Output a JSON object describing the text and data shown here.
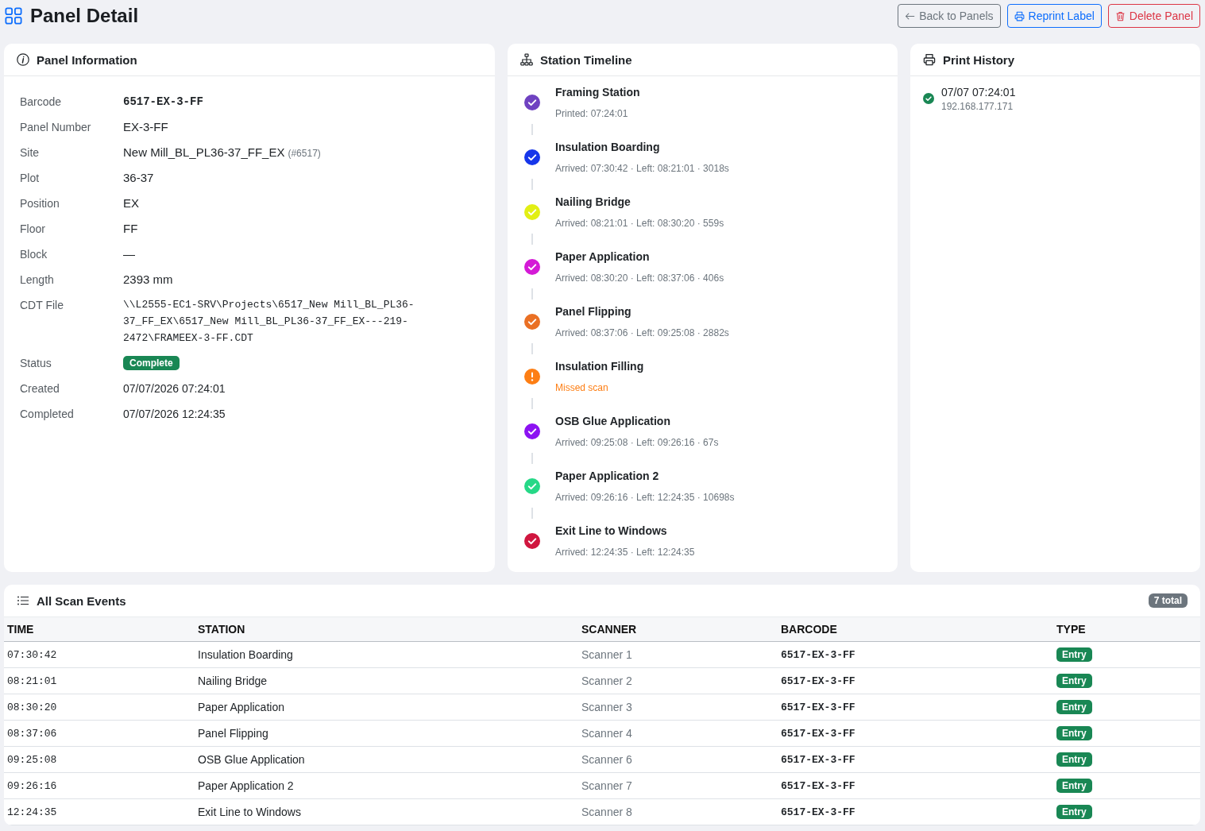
{
  "header": {
    "title": "Panel Detail",
    "buttons": [
      {
        "label": "Back to Panels",
        "kind": "back"
      },
      {
        "label": "Reprint Label",
        "kind": "reprint"
      },
      {
        "label": "Delete Panel",
        "kind": "delete"
      }
    ]
  },
  "panel_info": {
    "title": "Panel Information",
    "fields": [
      {
        "label": "Barcode",
        "value": "6517-EX-3-FF",
        "kind": "code-bold"
      },
      {
        "label": "Panel Number",
        "value": "EX-3-FF",
        "kind": "text"
      },
      {
        "label": "Site",
        "value": "New Mill_BL_PL36-37_FF_EX",
        "note": "(#6517)",
        "kind": "text"
      },
      {
        "label": "Plot",
        "value": "36-37",
        "kind": "text"
      },
      {
        "label": "Position",
        "value": "EX",
        "kind": "text"
      },
      {
        "label": "Floor",
        "value": "FF",
        "kind": "text"
      },
      {
        "label": "Block",
        "value": "—",
        "kind": "text"
      },
      {
        "label": "Length",
        "value": "2393 mm",
        "kind": "text"
      },
      {
        "label": "CDT File",
        "value": "\\\\L2555-EC1-SRV\\Projects\\6517_New Mill_BL_PL36-37_FF_EX\\6517_New Mill_BL_PL36-37_FF_EX---219-2472\\FRAMEEX-3-FF.CDT",
        "kind": "path"
      },
      {
        "label": "Status",
        "value": "Complete",
        "kind": "badge"
      },
      {
        "label": "Created",
        "value": "07/07/2026 07:24:01",
        "kind": "small"
      },
      {
        "label": "Completed",
        "value": "07/07/2026 12:24:35",
        "kind": "small"
      }
    ]
  },
  "timeline": {
    "title": "Station Timeline",
    "stations": [
      {
        "name": "Framing Station",
        "detail": "Printed: 07:24:01",
        "kind": "done",
        "color": "#6f42c1"
      },
      {
        "name": "Insulation Boarding",
        "detail": "Arrived: 07:30:42 · Left: 08:21:01 · 3018s",
        "kind": "done",
        "color": "#1636ea"
      },
      {
        "name": "Nailing Bridge",
        "detail": "Arrived: 08:21:01 · Left: 08:30:20 · 559s",
        "kind": "done",
        "color": "#e2ef14"
      },
      {
        "name": "Paper Application",
        "detail": "Arrived: 08:30:20 · Left: 08:37:06 · 406s",
        "kind": "done",
        "color": "#d41ad6"
      },
      {
        "name": "Panel Flipping",
        "detail": "Arrived: 08:37:06 · Left: 09:25:08 · 2882s",
        "kind": "done",
        "color": "#ea7024"
      },
      {
        "name": "Insulation Filling",
        "detail": "Missed scan",
        "kind": "missed",
        "color": "#fd7e14"
      },
      {
        "name": "OSB Glue Application",
        "detail": "Arrived: 09:25:08 · Left: 09:26:16 · 67s",
        "kind": "done",
        "color": "#8c12f2"
      },
      {
        "name": "Paper Application 2",
        "detail": "Arrived: 09:26:16 · Left: 12:24:35 · 10698s",
        "kind": "done",
        "color": "#26d887"
      },
      {
        "name": "Exit Line to Windows",
        "detail": "Arrived: 12:24:35 · Left: 12:24:35",
        "kind": "done",
        "color": "#d0163f"
      }
    ]
  },
  "print_history": {
    "title": "Print History",
    "entries": [
      {
        "time": "07/07 07:24:01",
        "address": "192.168.177.171"
      }
    ]
  },
  "scan_events": {
    "title": "All Scan Events",
    "count": "7 total",
    "columns": [
      "TIME",
      "STATION",
      "SCANNER",
      "BARCODE",
      "TYPE"
    ],
    "rows": [
      {
        "time": "07:30:42",
        "station": "Insulation Boarding",
        "scanner": "Scanner 1",
        "barcode": "6517-EX-3-FF",
        "type": "Entry"
      },
      {
        "time": "08:21:01",
        "station": "Nailing Bridge",
        "scanner": "Scanner 2",
        "barcode": "6517-EX-3-FF",
        "type": "Entry"
      },
      {
        "time": "08:30:20",
        "station": "Paper Application",
        "scanner": "Scanner 3",
        "barcode": "6517-EX-3-FF",
        "type": "Entry"
      },
      {
        "time": "08:37:06",
        "station": "Panel Flipping",
        "scanner": "Scanner 4",
        "barcode": "6517-EX-3-FF",
        "type": "Entry"
      },
      {
        "time": "09:25:08",
        "station": "OSB Glue Application",
        "scanner": "Scanner 6",
        "barcode": "6517-EX-3-FF",
        "type": "Entry"
      },
      {
        "time": "09:26:16",
        "station": "Paper Application 2",
        "scanner": "Scanner 7",
        "barcode": "6517-EX-3-FF",
        "type": "Entry"
      },
      {
        "time": "12:24:35",
        "station": "Exit Line to Windows",
        "scanner": "Scanner 8",
        "barcode": "6517-EX-3-FF",
        "type": "Entry"
      }
    ]
  }
}
